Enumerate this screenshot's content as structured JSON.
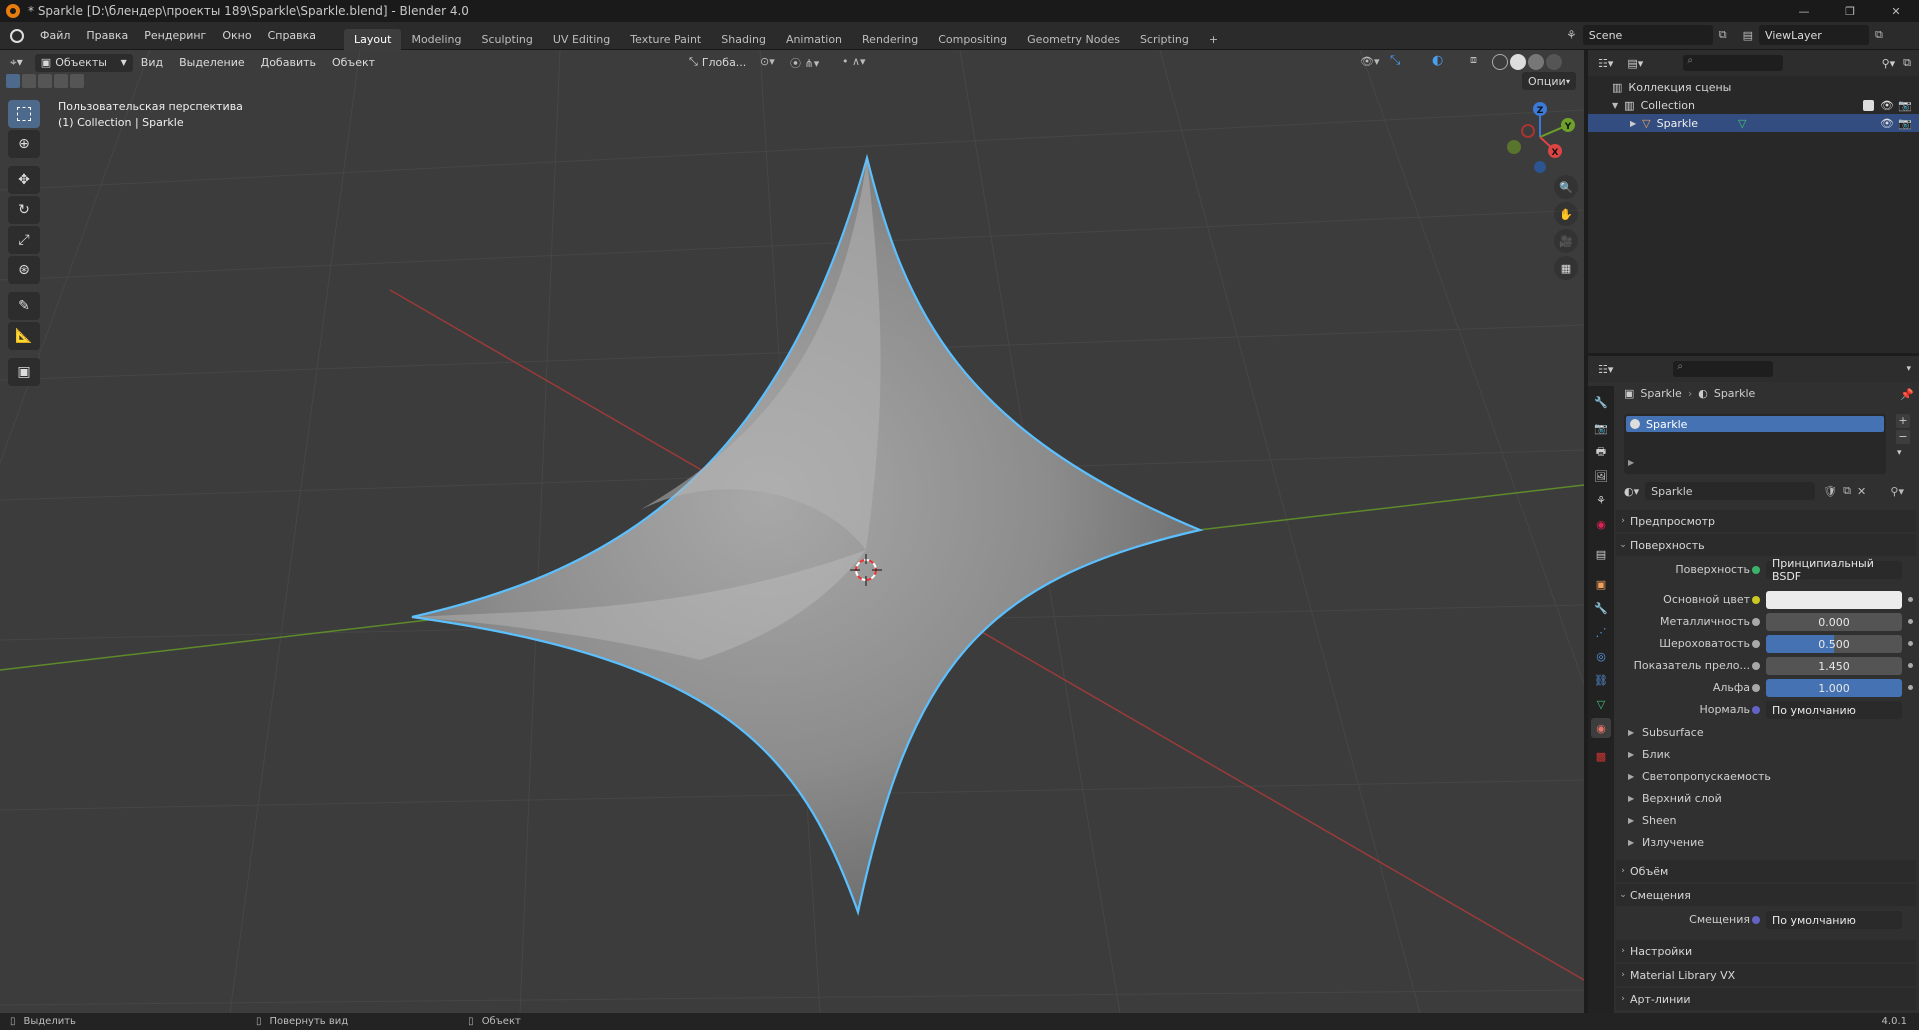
{
  "window": {
    "title": "* Sparkle [D:\\блендер\\проекты 189\\Sparkle\\Sparkle.blend] - Blender 4.0"
  },
  "menu": {
    "items": [
      "Файл",
      "Правка",
      "Рендеринг",
      "Окно",
      "Справка"
    ],
    "workspaces": [
      "Layout",
      "Modeling",
      "Sculpting",
      "UV Editing",
      "Texture Paint",
      "Shading",
      "Animation",
      "Rendering",
      "Compositing",
      "Geometry Nodes",
      "Scripting"
    ],
    "active_workspace": "Layout",
    "add_tab": "+",
    "scene": "Scene",
    "view_layer": "ViewLayer"
  },
  "viewport": {
    "mode": "Объекты",
    "menus": [
      "Вид",
      "Выделение",
      "Добавить",
      "Объект"
    ],
    "transform_orientation": "Глоба...",
    "options_label": "Опции",
    "overlay_title": "Пользовательская перспектива",
    "overlay_collection": "(1) Collection | Sparkle",
    "gizmo_axes": {
      "x": "X",
      "y": "Y",
      "z": "Z"
    },
    "colors": {
      "selection_outline": "#5cc0ff",
      "x_axis": "#b03a3a",
      "y_axis": "#6e9a2b",
      "background": "#3c3c3c"
    }
  },
  "outliner": {
    "root": "Коллекция сцены",
    "collection": "Collection",
    "object": "Sparkle"
  },
  "properties": {
    "breadcrumb": [
      "Sparkle",
      "Sparkle"
    ],
    "material_slot": "Sparkle",
    "material_name": "Sparkle",
    "panels": {
      "preview": "Предпросмотр",
      "surface": "Поверхность",
      "volume": "Объём",
      "displacement": "Смещения",
      "settings": "Настройки",
      "material_library": "Material Library VX",
      "line_art": "Арт-линии"
    },
    "surface_rows": [
      {
        "label": "Поверхность",
        "value": "Принципиальный BSDF"
      },
      {
        "label": "Основной цвет",
        "value": ""
      },
      {
        "label": "Металличность",
        "value": "0.000"
      },
      {
        "label": "Шероховатость",
        "value": "0.500"
      },
      {
        "label": "Показатель прело...",
        "value": "1.450"
      },
      {
        "label": "Альфа",
        "value": "1.000"
      },
      {
        "label": "Нормаль",
        "value": "По умолчанию"
      }
    ],
    "subpanels": [
      "Subsurface",
      "Блик",
      "Светопропускаемость",
      "Верхний слой",
      "Sheen",
      "Излучение"
    ],
    "displacement_row": {
      "label": "Смещения",
      "value": "По умолчанию"
    },
    "base_color": "#ececec",
    "roughness": 0.5,
    "alpha": 1.0
  },
  "status": {
    "select": "Выделить",
    "rotate": "Повернуть вид",
    "object": "Объект",
    "version": "4.0.1"
  }
}
